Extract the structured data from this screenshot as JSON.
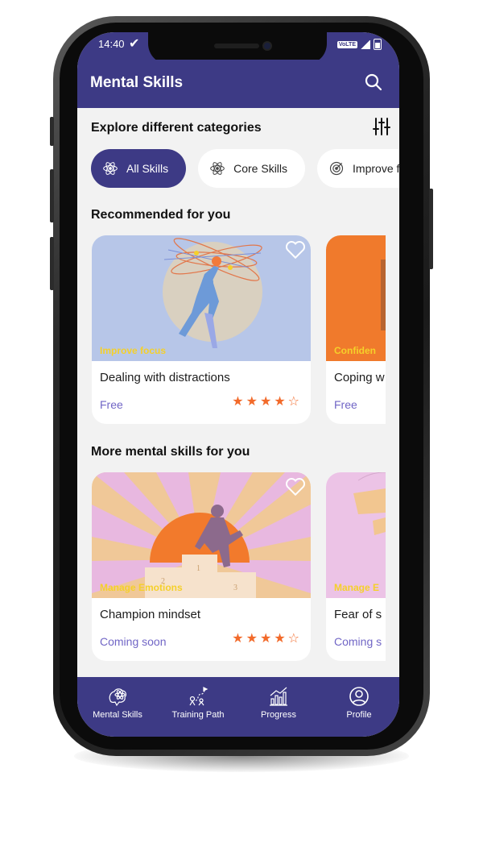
{
  "status_bar": {
    "time": "14:40",
    "network": "VoLTE"
  },
  "app_bar": {
    "title": "Mental Skills"
  },
  "categories": {
    "heading": "Explore different categories",
    "chips": [
      {
        "label": "All Skills",
        "icon": "atom-icon",
        "active": true
      },
      {
        "label": "Core Skills",
        "icon": "atom-icon",
        "active": false
      },
      {
        "label": "Improve fo",
        "icon": "target-icon",
        "active": false
      }
    ]
  },
  "recommended": {
    "heading": "Recommended for you",
    "cards": [
      {
        "category": "Improve focus",
        "title": "Dealing with distractions",
        "price": "Free",
        "rating": 4,
        "max_rating": 5
      },
      {
        "category": "Confiden",
        "title": "Coping w",
        "price": "Free"
      }
    ]
  },
  "more_skills": {
    "heading": "More mental skills for you",
    "cards": [
      {
        "category": "Manage Emotions",
        "title": "Champion mindset",
        "price": "Coming soon",
        "rating": 4,
        "max_rating": 5
      },
      {
        "category": "Manage E",
        "title": "Fear of s",
        "price": "Coming s"
      }
    ]
  },
  "bottom_nav": [
    {
      "label": "Mental Skills",
      "icon": "brain-icon"
    },
    {
      "label": "Training Path",
      "icon": "path-icon"
    },
    {
      "label": "Progress",
      "icon": "chart-icon"
    },
    {
      "label": "Profile",
      "icon": "user-icon"
    }
  ],
  "colors": {
    "primary": "#3d3a85",
    "accent": "#f26a2a",
    "price": "#7166c6",
    "category": "#f5d02a",
    "background": "#f2f2f2"
  }
}
